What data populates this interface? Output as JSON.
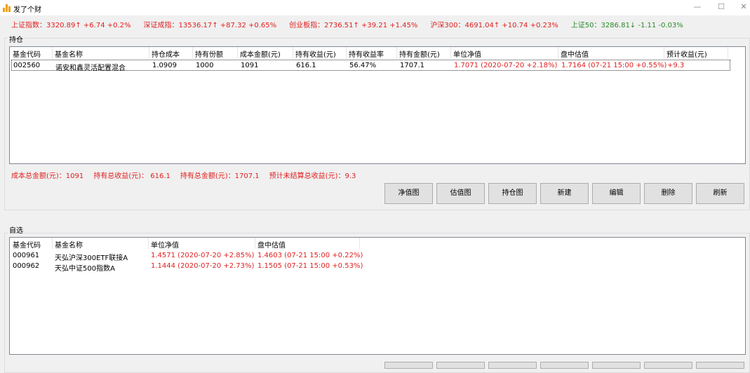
{
  "window": {
    "title": "发了个财",
    "minimize": "—",
    "maximize": "☐",
    "close": "✕"
  },
  "indices": [
    {
      "text": "上证指数：3320.89↑ +6.74  +0.2%",
      "trend": "up"
    },
    {
      "text": "深证成指：13536.17↑ +87.32  +0.65%",
      "trend": "up"
    },
    {
      "text": "创业板指：2736.51↑ +39.21  +1.45%",
      "trend": "up"
    },
    {
      "text": "沪深300：4691.04↑ +10.74  +0.23%",
      "trend": "up"
    },
    {
      "text": "上证50：3286.81↓ -1.11  -0.03%",
      "trend": "down"
    }
  ],
  "holdings": {
    "label": "持仓",
    "columns": [
      "基金代码",
      "基金名称",
      "持仓成本",
      "持有份额",
      "成本金额(元)",
      "持有收益(元)",
      "持有收益率",
      "持有金额(元)",
      "单位净值",
      "盘中估值",
      "预计收益(元)"
    ],
    "rows": [
      [
        "002560",
        "诺安和鑫灵活配置混合",
        "1.0909",
        "1000",
        "1091",
        "616.1",
        "56.47%",
        "1707.1",
        "1.7071 (2020-07-20  +2.18%)",
        "1.7164 (07-21 15:00  +0.55%)",
        "+9.3"
      ]
    ],
    "summary": [
      "成本总金额(元)：1091",
      "持有总收益(元)： 616.1",
      "持有总金额(元)：1707.1",
      "预计未结算总收益(元)：9.3"
    ],
    "buttons": [
      "净值图",
      "估值图",
      "持仓图",
      "新建",
      "编辑",
      "删除",
      "刷新"
    ]
  },
  "watchlist": {
    "label": "自选",
    "columns": [
      "基金代码",
      "基金名称",
      "单位净值",
      "盘中估值"
    ],
    "rows": [
      [
        "000961",
        "天弘沪深300ETF联接A",
        "1.4571 (2020-07-20  +2.85%)",
        "1.4603 (07-21 15:00  +0.22%)"
      ],
      [
        "000962",
        "天弘中证500指数A",
        "1.1444 (2020-07-20  +2.73%)",
        "1.1505 (07-21 15:00  +0.53%)"
      ]
    ]
  },
  "colors": {
    "up": "#e02020",
    "down": "#2a8a2a"
  }
}
